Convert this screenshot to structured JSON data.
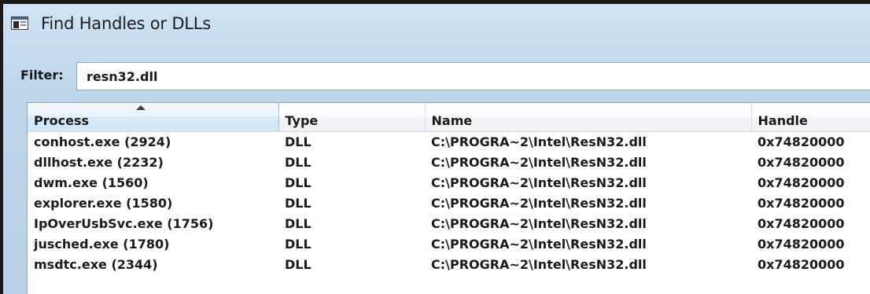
{
  "window": {
    "title": "Find Handles or DLLs",
    "icon": "window-app-icon"
  },
  "filter": {
    "label": "Filter:",
    "value": "resn32.dll"
  },
  "table": {
    "sorted_column": "Process",
    "sort_direction": "ascending",
    "columns": [
      "Process",
      "Type",
      "Name",
      "Handle"
    ],
    "rows": [
      [
        "conhost.exe (2924)",
        "DLL",
        "C:\\PROGRA~2\\Intel\\ResN32.dll",
        "0x74820000"
      ],
      [
        "dllhost.exe (2232)",
        "DLL",
        "C:\\PROGRA~2\\Intel\\ResN32.dll",
        "0x74820000"
      ],
      [
        "dwm.exe (1560)",
        "DLL",
        "C:\\PROGRA~2\\Intel\\ResN32.dll",
        "0x74820000"
      ],
      [
        "explorer.exe (1580)",
        "DLL",
        "C:\\PROGRA~2\\Intel\\ResN32.dll",
        "0x74820000"
      ],
      [
        "IpOverUsbSvc.exe (1756)",
        "DLL",
        "C:\\PROGRA~2\\Intel\\ResN32.dll",
        "0x74820000"
      ],
      [
        "jusched.exe (1780)",
        "DLL",
        "C:\\PROGRA~2\\Intel\\ResN32.dll",
        "0x74820000"
      ],
      [
        "msdtc.exe (2344)",
        "DLL",
        "C:\\PROGRA~2\\Intel\\ResN32.dll",
        "0x74820000"
      ]
    ]
  },
  "colors": {
    "window_chrome": "#c7dcef",
    "sorted_header": "#d6ebf8",
    "text": "#1a1a1a"
  }
}
